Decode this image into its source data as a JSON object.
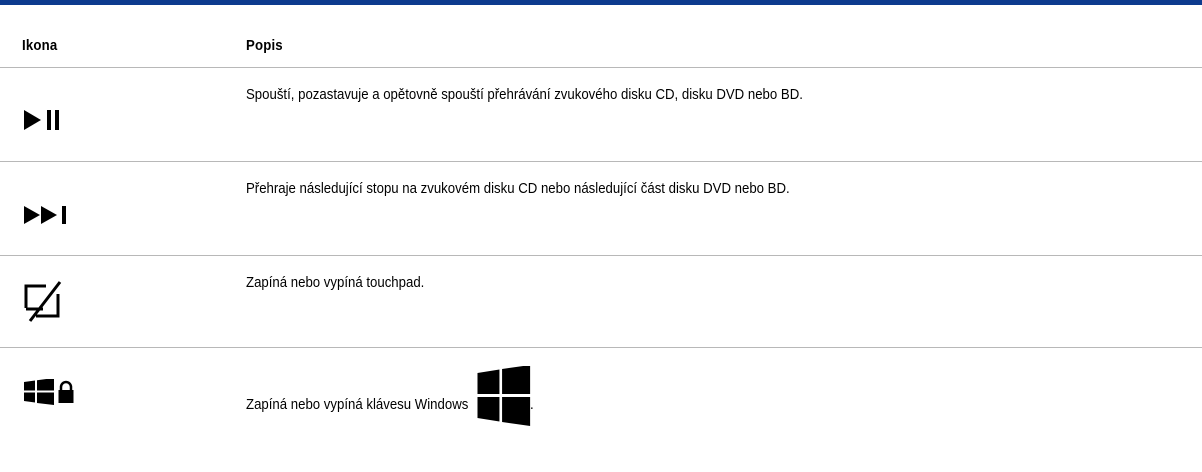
{
  "table": {
    "header": {
      "icon_label": "Ikona",
      "desc_label": "Popis"
    },
    "rows": [
      {
        "icon": "play-pause-icon",
        "description": "Spouští, pozastavuje a opětovně spouští přehrávání zvukového disku CD, disku DVD nebo BD."
      },
      {
        "icon": "next-track-icon",
        "description": "Přehraje následující stopu na zvukovém disku CD nebo následující část disku DVD nebo BD."
      },
      {
        "icon": "touchpad-toggle-icon",
        "description": "Zapíná nebo vypíná touchpad."
      },
      {
        "icon": "windows-lock-icon",
        "description": "Zapíná nebo vypíná klávesu Windows",
        "inline_icon": "windows-logo-icon",
        "suffix": "."
      }
    ]
  },
  "colors": {
    "rule": "#0d3b8e",
    "text": "#000000",
    "divider": "#b8b8b8"
  }
}
